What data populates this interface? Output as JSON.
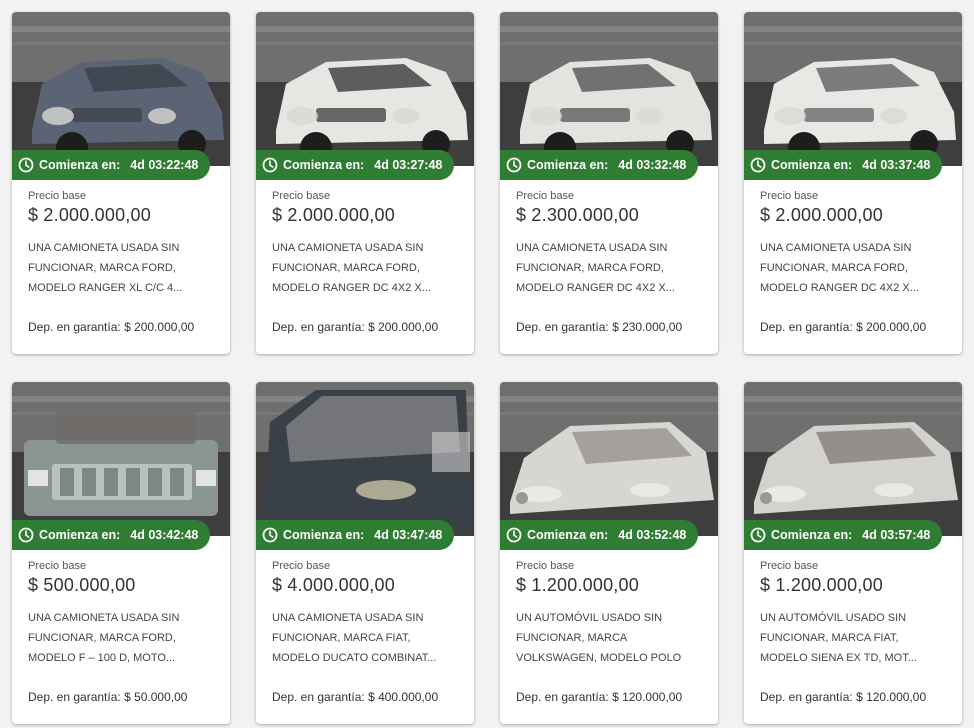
{
  "colors": {
    "badge": "#2e7d32",
    "background": "#f2f2f2",
    "card": "#ffffff"
  },
  "listings": [
    {
      "countdown_label": "Comienza en:",
      "countdown": "4d 03:22:48",
      "price_label": "Precio base",
      "price": "$ 2.000.000,00",
      "description": "UNA CAMIONETA USADA SIN FUNCIONAR, MARCA FORD, MODELO RANGER XL C/C 4...",
      "deposit": "Dep. en garantía: $ 200.000,00",
      "photo": {
        "body": "#5a6475",
        "tone": "#3b3f45",
        "kind": "pickup"
      }
    },
    {
      "countdown_label": "Comienza en:",
      "countdown": "4d 03:27:48",
      "price_label": "Precio base",
      "price": "$ 2.000.000,00",
      "description": "UNA CAMIONETA USADA SIN FUNCIONAR, MARCA FORD, MODELO RANGER DC 4X2 X...",
      "deposit": "Dep. en garantía: $ 200.000,00",
      "photo": {
        "body": "#e6e6e2",
        "tone": "#2d2f31",
        "kind": "pickup"
      }
    },
    {
      "countdown_label": "Comienza en:",
      "countdown": "4d 03:32:48",
      "price_label": "Precio base",
      "price": "$ 2.300.000,00",
      "description": "UNA CAMIONETA USADA SIN FUNCIONAR, MARCA FORD, MODELO RANGER DC 4X2 X...",
      "deposit": "Dep. en garantía: $ 230.000,00",
      "photo": {
        "body": "#e4e3df",
        "tone": "#4a4b4d",
        "kind": "pickup"
      }
    },
    {
      "countdown_label": "Comienza en:",
      "countdown": "4d 03:37:48",
      "price_label": "Precio base",
      "price": "$ 2.000.000,00",
      "description": "UNA CAMIONETA USADA SIN FUNCIONAR, MARCA FORD, MODELO RANGER DC 4X2 X...",
      "deposit": "Dep. en garantía: $ 200.000,00",
      "photo": {
        "body": "#e8e8e5",
        "tone": "#55585b",
        "kind": "pickup"
      }
    },
    {
      "countdown_label": "Comienza en:",
      "countdown": "4d 03:42:48",
      "price_label": "Precio base",
      "price": "$ 500.000,00",
      "description": "UNA CAMIONETA USADA SIN FUNCIONAR, MARCA FORD, MODELO F – 100 D, MOTO...",
      "deposit": "Dep. en garantía: $ 50.000,00",
      "photo": {
        "body": "#8a9694",
        "tone": "#6e6a66",
        "kind": "truck"
      }
    },
    {
      "countdown_label": "Comienza en:",
      "countdown": "4d 03:47:48",
      "price_label": "Precio base",
      "price": "$ 4.000.000,00",
      "description": "UNA CAMIONETA USADA SIN FUNCIONAR, MARCA FIAT, MODELO DUCATO COMBINAT...",
      "deposit": "Dep. en garantía: $ 400.000,00",
      "photo": {
        "body": "#3a4048",
        "tone": "#9a9a9a",
        "kind": "van"
      }
    },
    {
      "countdown_label": "Comienza en:",
      "countdown": "4d 03:52:48",
      "price_label": "Precio base",
      "price": "$ 1.200.000,00",
      "description": "UN AUTOMÓVIL USADO SIN FUNCIONAR, MARCA VOLKSWAGEN, MODELO POLO CLASS...",
      "deposit": "Dep. en garantía: $ 120.000,00",
      "photo": {
        "body": "#d8d6d0",
        "tone": "#7a7672",
        "kind": "sedan"
      }
    },
    {
      "countdown_label": "Comienza en:",
      "countdown": "4d 03:57:48",
      "price_label": "Precio base",
      "price": "$ 1.200.000,00",
      "description": "UN AUTOMÓVIL USADO SIN FUNCIONAR, MARCA FIAT, MODELO SIENA EX TD, MOT...",
      "deposit": "Dep. en garantía: $ 120.000,00",
      "photo": {
        "body": "#d4d2cc",
        "tone": "#5c5a57",
        "kind": "sedan"
      }
    }
  ]
}
